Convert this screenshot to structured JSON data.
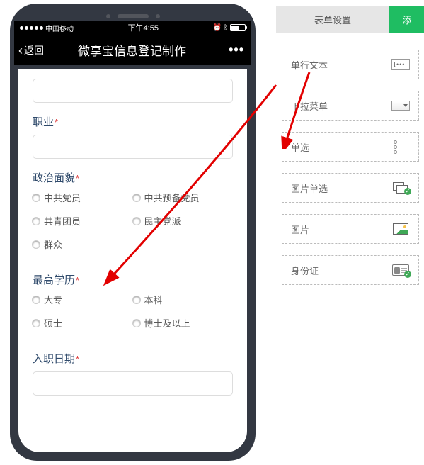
{
  "status": {
    "carrier": "中国移动",
    "time": "下午4:55"
  },
  "nav": {
    "back": "返回",
    "title": "微享宝信息登记制作",
    "more": "•••"
  },
  "form": {
    "occupation": {
      "label": "职业"
    },
    "political": {
      "label": "政治面貌",
      "options": [
        "中共党员",
        "中共预备党员",
        "共青团员",
        "民主党派",
        "群众"
      ]
    },
    "education": {
      "label": "最高学历",
      "options": [
        "大专",
        "本科",
        "硕士",
        "博士及以上"
      ]
    },
    "hiredate": {
      "label": "入职日期"
    }
  },
  "panel": {
    "tab_settings": "表单设置",
    "tab_add": "添",
    "components": {
      "text": "单行文本",
      "select": "下拉菜单",
      "radio": "单选",
      "imgradio": "图片单选",
      "image": "图片",
      "idcard": "身份证"
    },
    "text_icon_glyph": "I•••"
  },
  "req_mark": "*"
}
